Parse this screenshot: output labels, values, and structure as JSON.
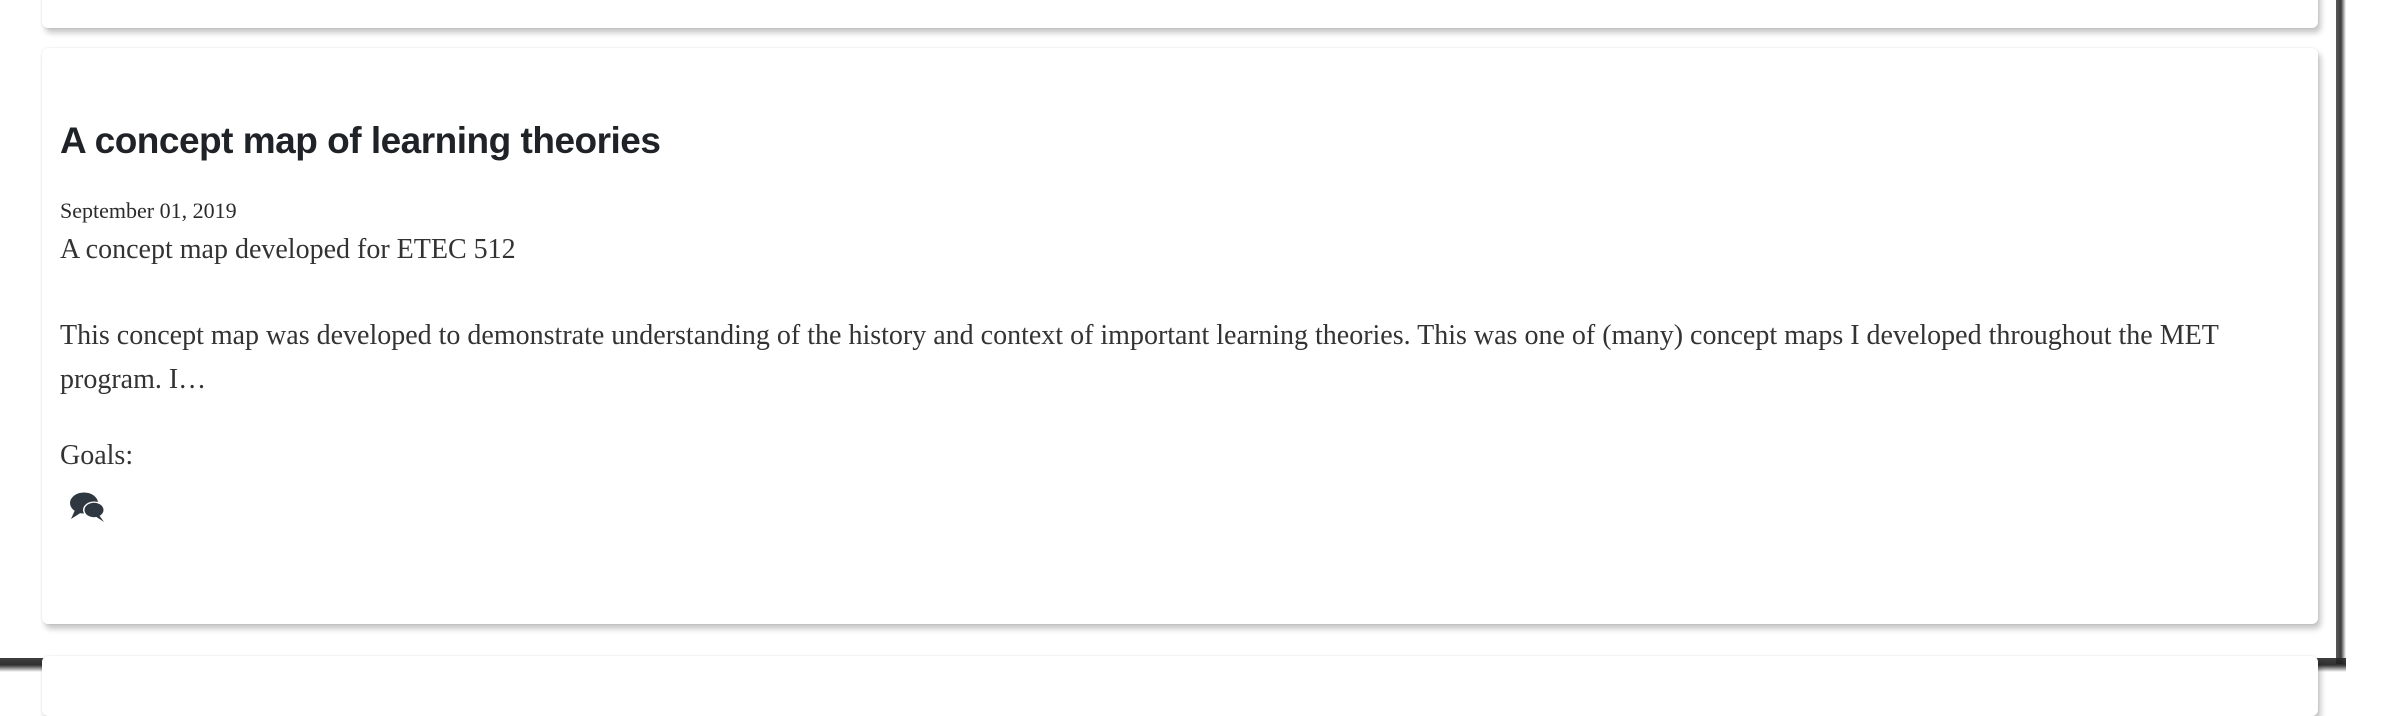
{
  "post": {
    "title": "A concept map of learning theories",
    "date": "September 01, 2019",
    "subtitle": "A concept map developed for ETEC 512",
    "excerpt": "This concept map was developed to demonstrate understanding of the history and context of important learning theories. This was one of (many) concept maps I developed throughout the MET program. I…",
    "goals_label": "Goals:",
    "comment_icon": "comments-icon"
  },
  "colors": {
    "title": "#1f2328",
    "body_text": "#333333",
    "icon": "#2f3740"
  }
}
